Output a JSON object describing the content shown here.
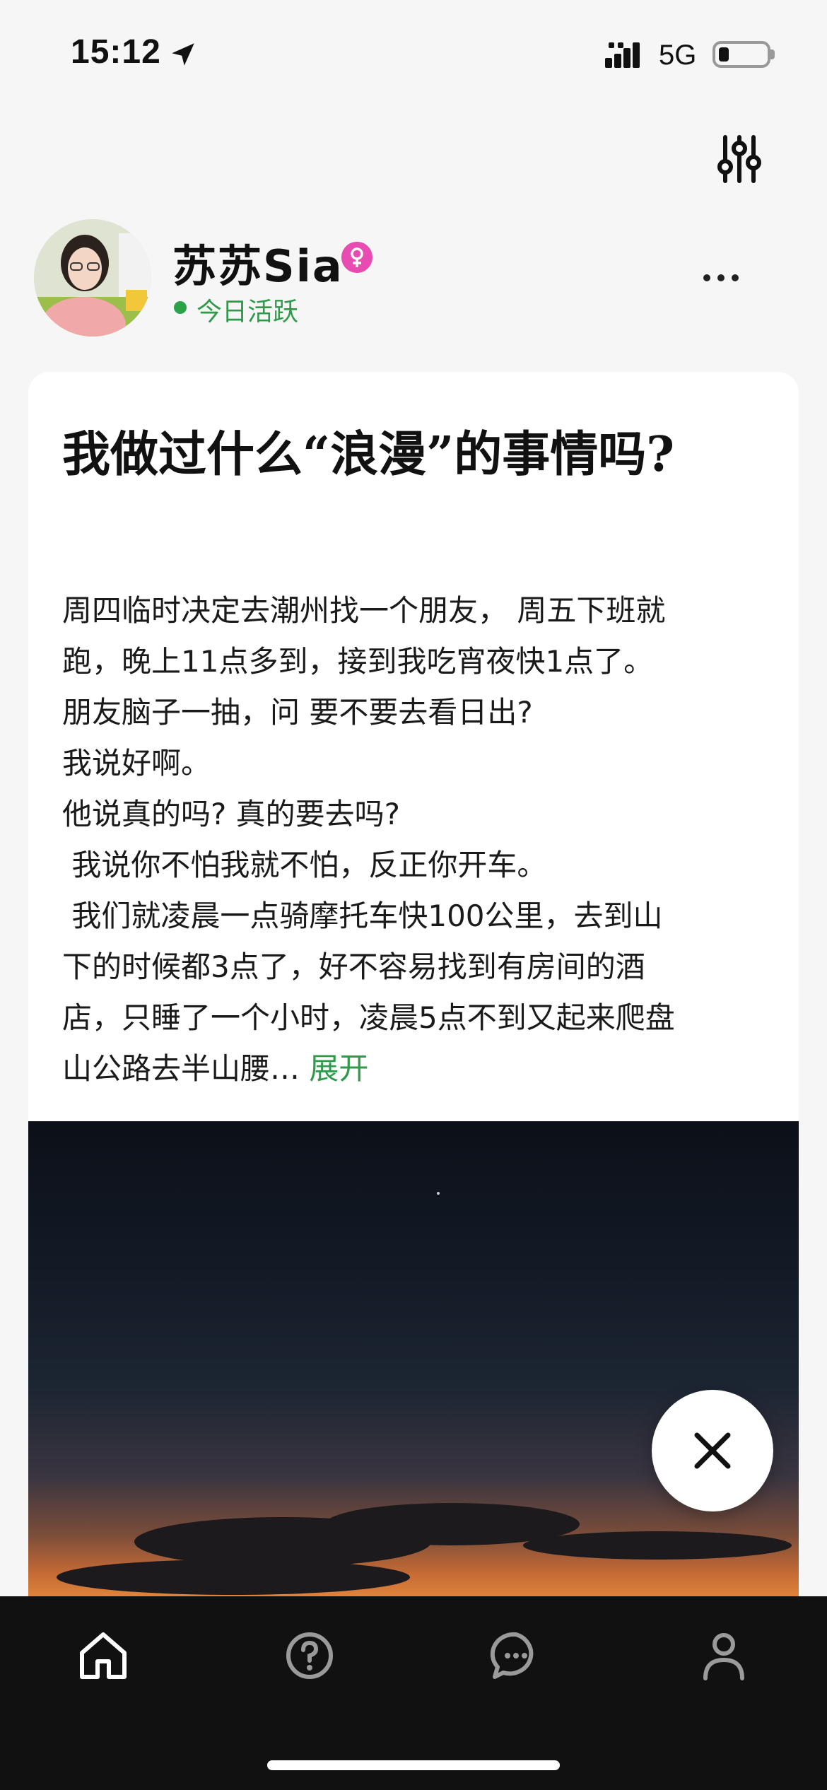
{
  "status_bar": {
    "time": "15:12",
    "network": "5G",
    "icons": [
      "location-arrow-icon",
      "signal-bars-icon",
      "battery-icon"
    ]
  },
  "toolbar": {
    "filter_icon": "sliders-icon",
    "more_icon": "more-dots-icon"
  },
  "user": {
    "name": "苏苏Sia",
    "gender_icon": "female-icon",
    "status": "今日活跃"
  },
  "post": {
    "title": "我做过什么“浪漫”的事情吗?",
    "lines": [
      "周四临时决定去潮州找一个朋友， 周五下班就",
      "跑，晚上11点多到，接到我吃宵夜快1点了。",
      "朋友脑子一抽，问 要不要去看日出?",
      "我说好啊。",
      "他说真的吗? 真的要去吗?",
      " 我说你不怕我就不怕，反正你开车。",
      " 我们就凌晨一点骑摩托车快100公里，去到山",
      "下的时候都3点了，好不容易找到有房间的酒",
      "店，只睡了一个小时，凌晨5点不到又起来爬盘",
      "山公路去半山腰… "
    ],
    "expand_label": "展开",
    "image": "sunrise-sky-photo"
  },
  "tab_bar": {
    "items": [
      "home-icon",
      "question-icon",
      "chat-icon",
      "profile-icon"
    ]
  },
  "colors": {
    "accent_green": "#2f9a4a",
    "gender_pink": "#e84bb1",
    "tab_bar_bg": "#111111"
  }
}
